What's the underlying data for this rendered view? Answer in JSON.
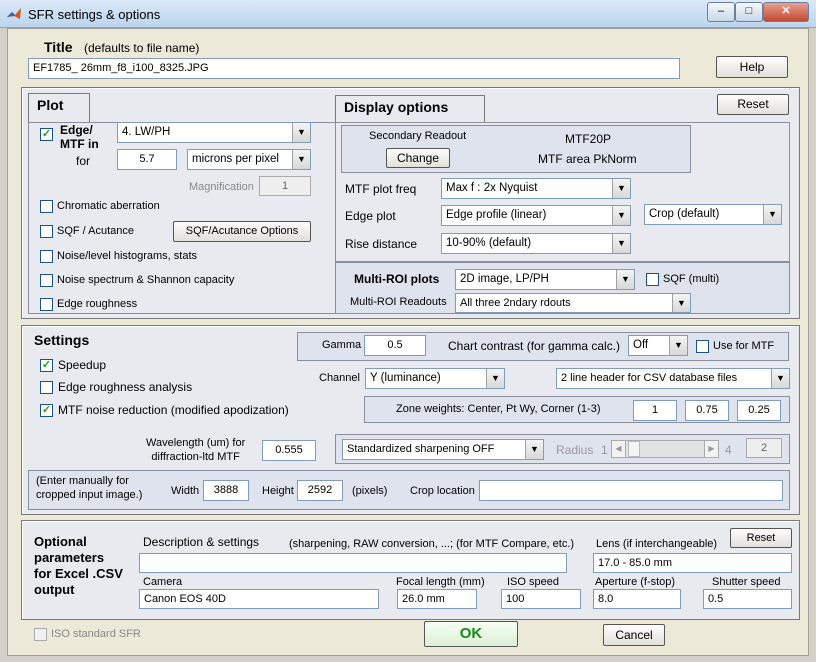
{
  "window": {
    "title": "SFR settings & options",
    "min": "–",
    "max": "□",
    "close": "✕"
  },
  "title_section": {
    "label": "Title",
    "hint": "(defaults to file name)",
    "value": "EF1785_ 26mm_f8_i100_8325.JPG",
    "help": "Help"
  },
  "plot": {
    "tab": "Plot",
    "edge_label": "Edge/\nMTF in",
    "edge_checked": "✓",
    "edge_select": "4. LW/PH",
    "for_label": "for",
    "for_value": "5.7",
    "units_select": "microns per pixel",
    "magnification_label": "Magnification",
    "magnification_value": "1",
    "chromatic": "Chromatic aberration",
    "sqf": "SQF / Acutance",
    "sqf_button": "SQF/Acutance Options",
    "noise_hist": "Noise/level histograms, stats",
    "noise_spectrum": "Noise spectrum & Shannon capacity",
    "edge_rough": "Edge roughness"
  },
  "display": {
    "tab": "Display options",
    "reset": "Reset",
    "secondary_label": "Secondary Readout",
    "change": "Change",
    "readout1": "MTF20P",
    "readout2": "MTF area PkNorm",
    "mtf_freq_label": "MTF plot freq",
    "mtf_freq_select": "Max f :    2x Nyquist",
    "edge_plot_label": "Edge plot",
    "edge_plot_select": "Edge profile (linear)",
    "crop_select": "Crop (default)",
    "rise_label": "Rise distance",
    "rise_select": "10-90% (default)",
    "multi_label": "Multi-ROI plots",
    "multi_select": "2D image, LP/PH",
    "sqf_multi": "SQF (multi)",
    "multi_readouts_label": "Multi-ROI Readouts",
    "multi_readouts_select": "All three 2ndary rdouts"
  },
  "settings": {
    "title": "Settings",
    "speedup": "Speedup",
    "edge_rough": "Edge roughness analysis",
    "mtf_noise": "MTF noise reduction (modified apodization)",
    "check": "✓",
    "gamma_label": "Gamma",
    "gamma_value": "0.5",
    "contrast_label": "Chart contrast (for gamma calc.)",
    "contrast_select": "Off",
    "use_mtf": "Use for MTF",
    "channel_label": "Channel",
    "channel_select": "Y (luminance)",
    "csv_select": "2 line header for CSV database files",
    "zone_label": "Zone weights:  Center, Pt Wy, Corner (1-3)",
    "zone": [
      "1",
      "0.75",
      "0.25"
    ],
    "wavelength_label": "Wavelength (um) for\ndiffraction-ltd MTF",
    "wavelength_value": "0.555",
    "sharpen_select": "Standardized sharpening OFF",
    "radius_label": "Radius",
    "radius_min": "1",
    "radius_max": "4",
    "radius_value": "2",
    "manual_label": "(Enter manually for\ncropped input image.)",
    "width_label": "Width",
    "width_value": "3888",
    "height_label": "Height",
    "height_value": "2592",
    "pixels": "(pixels)",
    "crop_label": "Crop location",
    "crop_value": ""
  },
  "optional": {
    "title": "Optional\nparameters\nfor Excel .CSV\noutput",
    "desc_label": "Description & settings",
    "desc_hint": "(sharpening, RAW conversion, ...; (for MTF Compare, etc.)",
    "desc_value": "",
    "lens_label": "Lens (if interchangeable)",
    "reset": "Reset",
    "lens_value": "17.0 - 85.0 mm",
    "camera_label": "Camera",
    "camera_value": "Canon EOS 40D",
    "focal_label": "Focal length (mm)",
    "focal_value": "26.0 mm",
    "iso_label": "ISO speed",
    "iso_value": "100",
    "aperture_label": "Aperture (f-stop)",
    "aperture_value": "8.0",
    "shutter_label": "Shutter speed",
    "shutter_value": "0.5"
  },
  "footer": {
    "iso_sfr": "ISO standard SFR",
    "ok": "OK",
    "cancel": "Cancel"
  },
  "colors": {
    "ok_text": "#1a8a1a",
    "check": "#21a121"
  }
}
